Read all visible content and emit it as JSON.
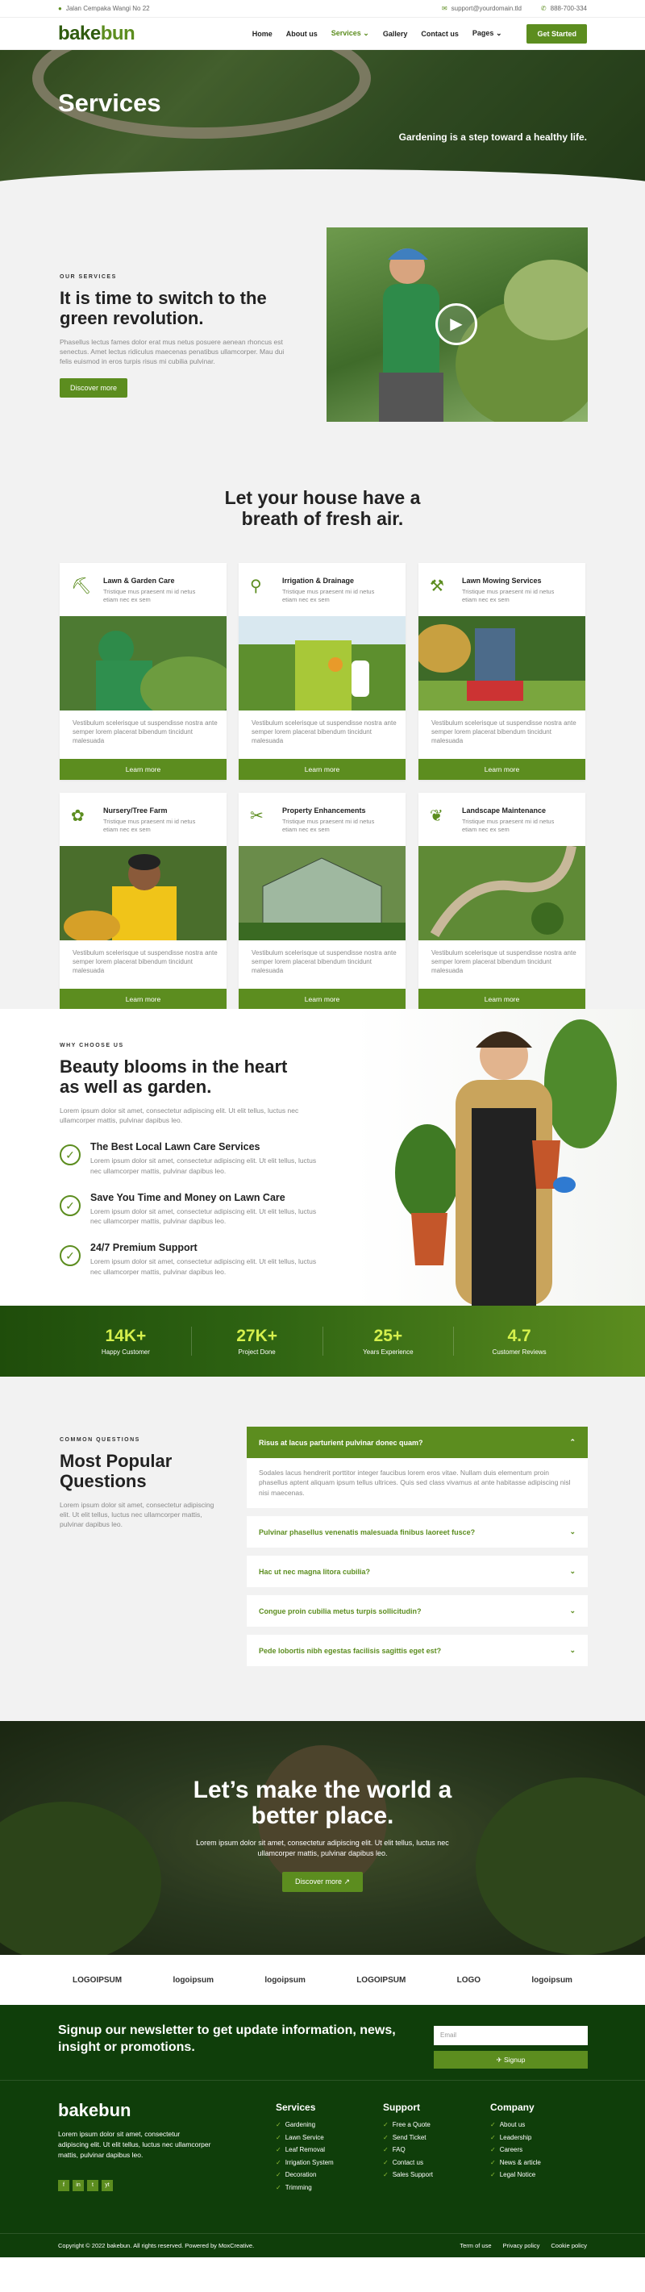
{
  "topbar": {
    "address": "Jalan Cempaka Wangi No 22",
    "email": "support@yourdomain.tld",
    "phone": "888-700-334"
  },
  "brand": {
    "prefix": "bake",
    "suffix": "bun"
  },
  "nav": {
    "items": [
      "Home",
      "About us",
      "Services",
      "Gallery",
      "Contact us",
      "Pages"
    ],
    "cta": "Get Started"
  },
  "hero": {
    "title": "Services",
    "tagline": "Gardening is a step toward a healthy life."
  },
  "intro": {
    "eyebrow": "OUR SERVICES",
    "title": "It is time to switch to the green revolution.",
    "text": "Phasellus lectus fames dolor erat mus netus posuere aenean rhoncus est senectus. Amet lectus ridiculus maecenas penatibus ullamcorper. Mau dui felis euismod in eros turpis risus mi cubilia pulvinar.",
    "button": "Discover more"
  },
  "services": {
    "title": "Let your house have a breath of fresh air.",
    "items": [
      {
        "title": "Lawn & Garden Care",
        "short": "Tristique mus praesent mi id netus etiam nec ex sem",
        "desc": "Vestibulum scelerisque ut suspendisse nostra ante semper lorem placerat bibendum tincidunt malesuada",
        "button": "Learn more",
        "icon": "shovel-icon"
      },
      {
        "title": "Irrigation & Drainage",
        "short": "Tristique mus praesent mi id netus etiam nec ex sem",
        "desc": "Vestibulum scelerisque ut suspendisse nostra ante semper lorem placerat bibendum tincidunt malesuada",
        "button": "Learn more",
        "icon": "watering-icon"
      },
      {
        "title": "Lawn Mowing Services",
        "short": "Tristique mus praesent mi id netus etiam nec ex sem",
        "desc": "Vestibulum scelerisque ut suspendisse nostra ante semper lorem placerat bibendum tincidunt malesuada",
        "button": "Learn more",
        "icon": "mower-icon"
      },
      {
        "title": "Nursery/Tree Farm",
        "short": "Tristique mus praesent mi id netus etiam nec ex sem",
        "desc": "Vestibulum scelerisque ut suspendisse nostra ante semper lorem placerat bibendum tincidunt malesuada",
        "button": "Learn more",
        "icon": "seedling-icon"
      },
      {
        "title": "Property Enhancements",
        "short": "Tristique mus praesent mi id netus etiam nec ex sem",
        "desc": "Vestibulum scelerisque ut suspendisse nostra ante semper lorem placerat bibendum tincidunt malesuada",
        "button": "Learn more",
        "icon": "tools-icon"
      },
      {
        "title": "Landscape Maintenance",
        "short": "Tristique mus praesent mi id netus etiam nec ex sem",
        "desc": "Vestibulum scelerisque ut suspendisse nostra ante semper lorem placerat bibendum tincidunt malesuada",
        "button": "Learn more",
        "icon": "leaf-icon"
      }
    ]
  },
  "why": {
    "eyebrow": "WHY CHOOSE US",
    "title": "Beauty blooms in the heart as well as garden.",
    "text": "Lorem ipsum dolor sit amet, consectetur adipiscing elit. Ut elit tellus, luctus nec ullamcorper mattis, pulvinar dapibus leo.",
    "features": [
      {
        "title": "The Best Local Lawn Care Services",
        "text": "Lorem ipsum dolor sit amet, consectetur adipiscing elit. Ut elit tellus, luctus nec ullamcorper mattis, pulvinar dapibus leo."
      },
      {
        "title": "Save You Time and Money on Lawn Care",
        "text": "Lorem ipsum dolor sit amet, consectetur adipiscing elit. Ut elit tellus, luctus nec ullamcorper mattis, pulvinar dapibus leo."
      },
      {
        "title": "24/7 Premium Support",
        "text": "Lorem ipsum dolor sit amet, consectetur adipiscing elit. Ut elit tellus, luctus nec ullamcorper mattis, pulvinar dapibus leo."
      }
    ]
  },
  "stats": [
    {
      "value": "14K+",
      "label": "Happy Customer"
    },
    {
      "value": "27K+",
      "label": "Project Done"
    },
    {
      "value": "25+",
      "label": "Years Experience"
    },
    {
      "value": "4.7",
      "label": "Customer Reviews"
    }
  ],
  "faq": {
    "eyebrow": "COMMON QUESTIONS",
    "title": "Most Popular Questions",
    "text": "Lorem ipsum dolor sit amet, consectetur adipiscing elit. Ut elit tellus, luctus nec ullamcorper mattis, pulvinar dapibus leo.",
    "open_q": "Risus at lacus parturient pulvinar donec quam?",
    "open_a": "Sodales lacus hendrerit porttitor integer faucibus lorem eros vitae. Nullam duis elementum proin phasellus aptent aliquam ipsum tellus ultrices. Quis sed class vivamus at ante habitasse adipiscing nisl nisi maecenas.",
    "questions": [
      "Pulvinar phasellus venenatis malesuada finibus laoreet fusce?",
      "Hac ut nec magna litora cubilia?",
      "Congue proin cubilia metus turpis sollicitudin?",
      "Pede lobortis nibh egestas facilisis sagittis eget est?"
    ]
  },
  "cta": {
    "title": "Let’s make the world a better place.",
    "text": "Lorem ipsum dolor sit amet, consectetur adipiscing elit. Ut elit tellus, luctus nec ullamcorper mattis, pulvinar dapibus leo.",
    "button": "Discover more ↗"
  },
  "logos": [
    "LOGOIPSUM",
    "logoipsum",
    "logoipsum",
    "LOGOIPSUM",
    "LOGO",
    "logoipsum"
  ],
  "newsletter": {
    "title": "Signup our newsletter to get update information, news, insight or promotions.",
    "placeholder": "Email",
    "button": "Signup"
  },
  "footer": {
    "about": "Lorem ipsum dolor sit amet, consectetur adipiscing elit. Ut elit tellus, luctus nec ullamcorper mattis, pulvinar dapibus leo.",
    "social": [
      "f",
      "in",
      "t",
      "yt"
    ],
    "cols": [
      {
        "title": "Services",
        "links": [
          "Gardening",
          "Lawn Service",
          "Leaf Removal",
          "Irrigation System",
          "Decoration",
          "Trimming"
        ]
      },
      {
        "title": "Support",
        "links": [
          "Free a Quote",
          "Send Ticket",
          "FAQ",
          "Contact us",
          "Sales Support"
        ]
      },
      {
        "title": "Company",
        "links": [
          "About us",
          "Leadership",
          "Careers",
          "News & article",
          "Legal Notice"
        ]
      }
    ],
    "copyright": "Copyright © 2022 bakebun. All rights reserved. Powered by MoxCreative.",
    "legal": [
      "Term of use",
      "Privacy policy",
      "Cookie policy"
    ]
  },
  "colors": {
    "accent": "#5c8d1f",
    "dark": "#0f3e0a",
    "stat": "#d5f04c"
  }
}
